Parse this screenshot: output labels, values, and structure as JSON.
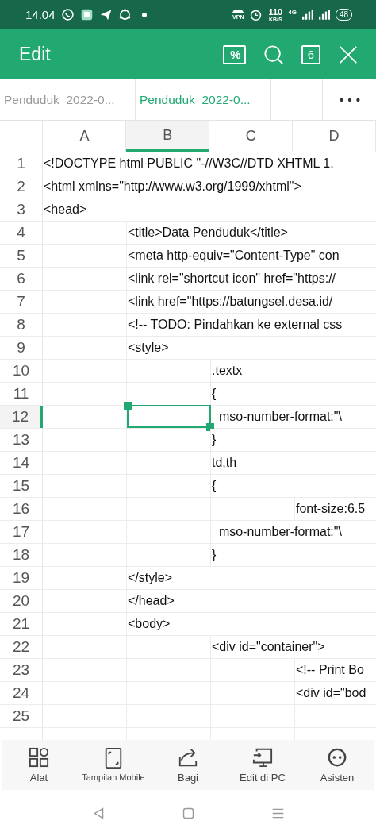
{
  "status_bar": {
    "time": "14.04",
    "vpn": "VPN",
    "speed": "110",
    "speed_unit": "KB/S",
    "network": "4G",
    "battery": "48"
  },
  "app_bar": {
    "title": "Edit",
    "sheet_count": "6",
    "percent_label": "%"
  },
  "tabs": [
    {
      "label": "Penduduk_2022-0...",
      "selected": false
    },
    {
      "label": "Penduduk_2022-0...",
      "selected": true
    }
  ],
  "columns": [
    {
      "label": "A",
      "selected": false
    },
    {
      "label": "B",
      "selected": true
    },
    {
      "label": "C",
      "selected": false
    },
    {
      "label": "D",
      "selected": false
    }
  ],
  "rows": [
    {
      "num": "1",
      "cells": [
        "<!DOCTYPE html PUBLIC \"-//W3C//DTD XHTML 1."
      ],
      "selected": false
    },
    {
      "num": "2",
      "cells": [
        "<html xmlns=\"http://www.w3.org/1999/xhtml\">"
      ],
      "selected": false
    },
    {
      "num": "3",
      "cells": [
        "<head>"
      ],
      "selected": false
    },
    {
      "num": "4",
      "cells": [
        null,
        "<title>Data Penduduk</title>"
      ],
      "selected": false
    },
    {
      "num": "5",
      "cells": [
        null,
        "<meta http-equiv=\"Content-Type\" con"
      ],
      "selected": false
    },
    {
      "num": "6",
      "cells": [
        null,
        "<link rel=\"shortcut icon\" href=\"https://"
      ],
      "selected": false
    },
    {
      "num": "7",
      "cells": [
        null,
        "<link href=\"https://batungsel.desa.id/"
      ],
      "selected": false
    },
    {
      "num": "8",
      "cells": [
        null,
        "<!-- TODO: Pindahkan ke external css"
      ],
      "selected": false
    },
    {
      "num": "9",
      "cells": [
        null,
        "<style>"
      ],
      "selected": false
    },
    {
      "num": "10",
      "cells": [
        null,
        null,
        ".textx"
      ],
      "selected": false
    },
    {
      "num": "11",
      "cells": [
        null,
        null,
        "{"
      ],
      "selected": false
    },
    {
      "num": "12",
      "cells": [
        null,
        null,
        "  mso-number-format:\"\\"
      ],
      "selected": true
    },
    {
      "num": "13",
      "cells": [
        null,
        null,
        "}"
      ],
      "selected": false
    },
    {
      "num": "14",
      "cells": [
        null,
        null,
        "td,th"
      ],
      "selected": false
    },
    {
      "num": "15",
      "cells": [
        null,
        null,
        "{"
      ],
      "selected": false
    },
    {
      "num": "16",
      "cells": [
        null,
        null,
        null,
        "font-size:6.5"
      ],
      "selected": false
    },
    {
      "num": "17",
      "cells": [
        null,
        null,
        "  mso-number-format:\"\\"
      ],
      "selected": false
    },
    {
      "num": "18",
      "cells": [
        null,
        null,
        "}"
      ],
      "selected": false
    },
    {
      "num": "19",
      "cells": [
        null,
        "</style>"
      ],
      "selected": false
    },
    {
      "num": "20",
      "cells": [
        null,
        "</head>"
      ],
      "selected": false
    },
    {
      "num": "21",
      "cells": [
        null,
        "<body>"
      ],
      "selected": false
    },
    {
      "num": "22",
      "cells": [
        null,
        null,
        "<div id=\"container\">"
      ],
      "selected": false
    },
    {
      "num": "23",
      "cells": [
        null,
        null,
        null,
        "<!-- Print Bo"
      ],
      "selected": false
    },
    {
      "num": "24",
      "cells": [
        null,
        null,
        null,
        "<div id=\"bod"
      ],
      "selected": false
    },
    {
      "num": "25",
      "selected": false
    }
  ],
  "toolbar": [
    {
      "kind": "tools",
      "label": "Alat"
    },
    {
      "kind": "mobile",
      "label": "Tampilan Mobile"
    },
    {
      "kind": "share",
      "label": "Bagi"
    },
    {
      "kind": "pc",
      "label": "Edit di PC"
    },
    {
      "kind": "assistant",
      "label": "Asisten"
    }
  ]
}
